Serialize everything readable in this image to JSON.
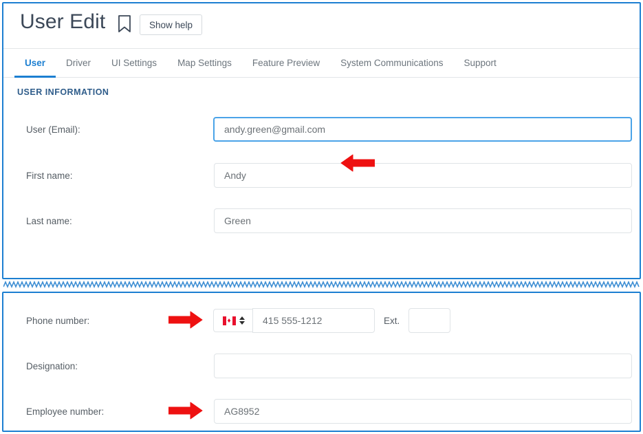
{
  "header": {
    "title": "User Edit",
    "bookmark_icon": "bookmark-icon",
    "help_button": "Show help"
  },
  "tabs": [
    {
      "label": "User",
      "active": true
    },
    {
      "label": "Driver",
      "active": false
    },
    {
      "label": "UI Settings",
      "active": false
    },
    {
      "label": "Map Settings",
      "active": false
    },
    {
      "label": "Feature Preview",
      "active": false
    },
    {
      "label": "System Communications",
      "active": false
    },
    {
      "label": "Support",
      "active": false
    }
  ],
  "user_information": {
    "section_title": "USER INFORMATION",
    "fields": {
      "email": {
        "label": "User (Email):",
        "value": "andy.green@gmail.com",
        "focused": true
      },
      "first_name": {
        "label": "First name:",
        "value": "Andy"
      },
      "last_name": {
        "label": "Last name:",
        "value": "Green"
      }
    }
  },
  "contact_information": {
    "fields": {
      "phone": {
        "label": "Phone number:",
        "country_flag": "canada-flag-icon",
        "value": "415 555-1212",
        "ext_label": "Ext.",
        "ext_value": ""
      },
      "designation": {
        "label": "Designation:",
        "value": ""
      },
      "employee_number": {
        "label": "Employee number:",
        "value": "AG8952"
      }
    }
  },
  "annotations": {
    "arrow_email": {
      "direction": "left"
    },
    "arrow_phone": {
      "direction": "right"
    },
    "arrow_employee": {
      "direction": "right"
    },
    "arrow_color": "#ee1111"
  },
  "colors": {
    "accent": "#1c7fd1",
    "section_heading": "#2e5c8a",
    "label_text": "#555d64",
    "input_text": "#6b7176",
    "border": "#dfe3e6",
    "focus_border": "#4aa3e8"
  }
}
